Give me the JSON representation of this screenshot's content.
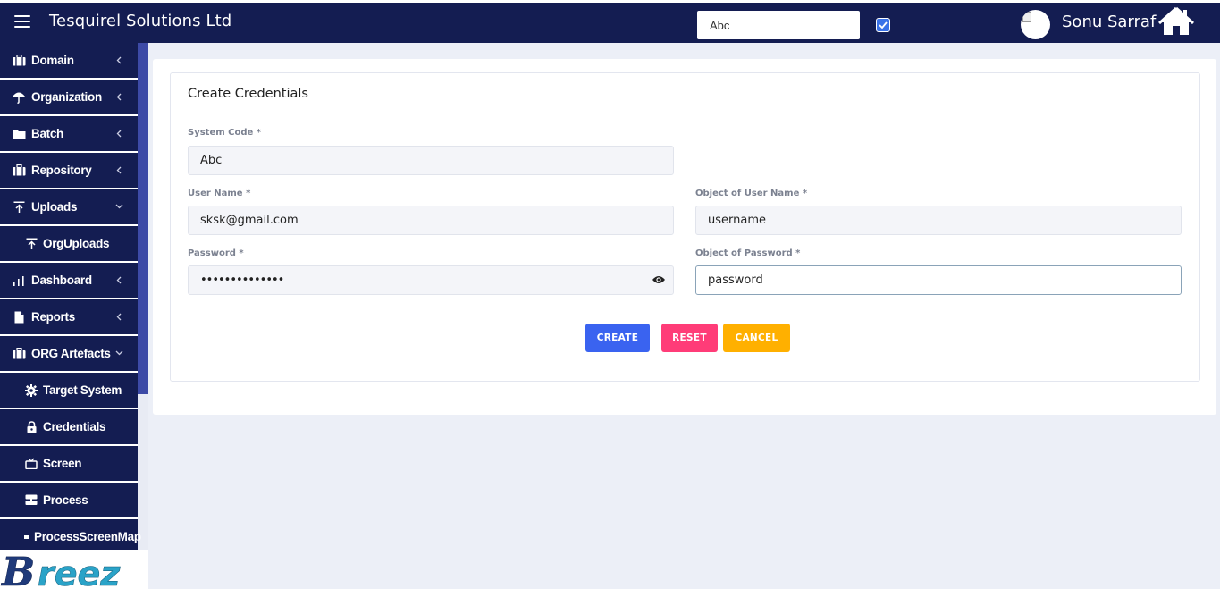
{
  "header": {
    "app_title": "Tesquirel Solutions Ltd",
    "search_value": "Abc",
    "checkbox_checked": true,
    "user_name": "Sonu Sarraf",
    "bg_color": "#141d52"
  },
  "sidebar": {
    "items": [
      {
        "label": "Domain",
        "icon": "briefcase-icon",
        "chevron": "left"
      },
      {
        "label": "Organization",
        "icon": "umbrella-icon",
        "chevron": "left"
      },
      {
        "label": "Batch",
        "icon": "folder-icon",
        "chevron": "left"
      },
      {
        "label": "Repository",
        "icon": "briefcase-icon",
        "chevron": "left"
      },
      {
        "label": "Uploads",
        "icon": "upload-icon",
        "chevron": "down"
      },
      {
        "label": "OrgUploads",
        "icon": "upload-icon"
      },
      {
        "label": "Dashboard",
        "icon": "bar-chart-icon",
        "chevron": "left"
      },
      {
        "label": "Reports",
        "icon": "file-icon",
        "chevron": "left"
      },
      {
        "label": "ORG Artefacts",
        "icon": "briefcase-icon",
        "chevron": "down"
      },
      {
        "label": "Target System",
        "icon": "cog-icon"
      },
      {
        "label": "Credentials",
        "icon": "lock-icon"
      },
      {
        "label": "Screen",
        "icon": "tv-icon"
      },
      {
        "label": "Process",
        "icon": "server-icon"
      },
      {
        "label": "ProcessScreenMap",
        "icon": "bullet-icon"
      }
    ]
  },
  "logo_text": "Breez",
  "form": {
    "title": "Create Credentials",
    "system_code": {
      "label": "System Code *",
      "value": "Abc"
    },
    "user_name": {
      "label": "User Name *",
      "value": "sksk@gmail.com"
    },
    "object_user_name": {
      "label": "Object of User Name *",
      "value": "username"
    },
    "password": {
      "label": "Password *",
      "value": "••••••••••••••"
    },
    "object_password": {
      "label": "Object of Password *",
      "value": "password"
    },
    "buttons": {
      "create": "CREATE",
      "reset": "RESET",
      "cancel": "CANCEL"
    }
  },
  "colors": {
    "create": "#3a63f0",
    "reset": "#ff3c78",
    "cancel": "#ffb000"
  }
}
